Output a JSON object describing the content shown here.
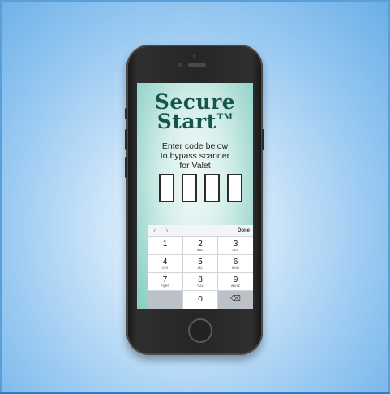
{
  "title": {
    "line1": "Secure",
    "line2": "Start",
    "trademark": "TM"
  },
  "instructions": [
    "Enter code below",
    "to bypass scanner",
    "for Valet"
  ],
  "code_digits": [
    "",
    "",
    "",
    ""
  ],
  "keyboard": {
    "prev_arrow": "‹",
    "next_arrow": "›",
    "done_label": "Done",
    "keys": [
      {
        "num": "1",
        "letters": ""
      },
      {
        "num": "2",
        "letters": "ABC"
      },
      {
        "num": "3",
        "letters": "DEF"
      },
      {
        "num": "4",
        "letters": "GHI"
      },
      {
        "num": "5",
        "letters": "JKL"
      },
      {
        "num": "6",
        "letters": "MNO"
      },
      {
        "num": "7",
        "letters": "PQRS"
      },
      {
        "num": "8",
        "letters": "TUV"
      },
      {
        "num": "9",
        "letters": "WXYZ"
      },
      {
        "num": "0",
        "letters": ""
      }
    ],
    "delete_glyph": "⌫"
  },
  "colors": {
    "title": "#16544f",
    "screen_bg": "#9fd8cf",
    "keyboard_bg": "#d1d5db",
    "page_bg": "#9ccbf2"
  },
  "icons": {
    "home_button": "home-button-icon",
    "delete": "backspace-icon"
  }
}
